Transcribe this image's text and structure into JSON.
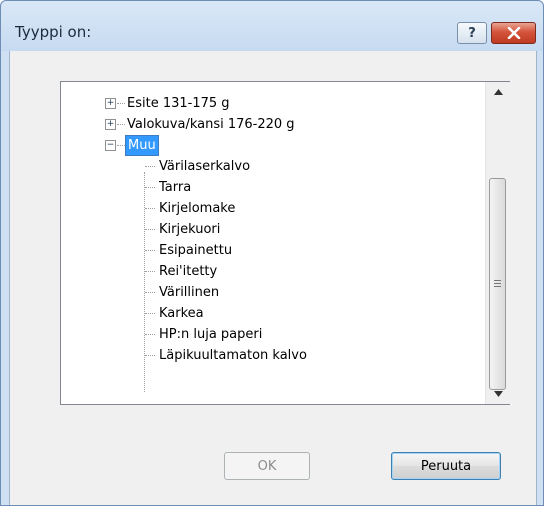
{
  "window": {
    "title": "Tyyppi on:",
    "help_label": "?",
    "close_icon": "close-icon"
  },
  "tree": {
    "items": [
      {
        "label": "Esite 131-175 g",
        "level": 0,
        "expander": "+"
      },
      {
        "label": "Valokuva/kansi 176-220 g",
        "level": 0,
        "expander": "+"
      },
      {
        "label": "Muu",
        "level": 0,
        "expander": "-",
        "selected": true
      },
      {
        "label": "Värilaserkalvo",
        "level": 1
      },
      {
        "label": "Tarra",
        "level": 1
      },
      {
        "label": "Kirjelomake",
        "level": 1
      },
      {
        "label": "Kirjekuori",
        "level": 1
      },
      {
        "label": "Esipainettu",
        "level": 1
      },
      {
        "label": "Rei'itetty",
        "level": 1
      },
      {
        "label": "Värillinen",
        "level": 1
      },
      {
        "label": "Karkea",
        "level": 1
      },
      {
        "label": "HP:n luja paperi",
        "level": 1
      },
      {
        "label": "Läpikuultamaton kalvo",
        "level": 1
      }
    ]
  },
  "buttons": {
    "ok": "OK",
    "cancel": "Peruuta"
  },
  "colors": {
    "selection": "#3399ff",
    "frame": "#cfe0f3",
    "close": "#c03a22"
  }
}
